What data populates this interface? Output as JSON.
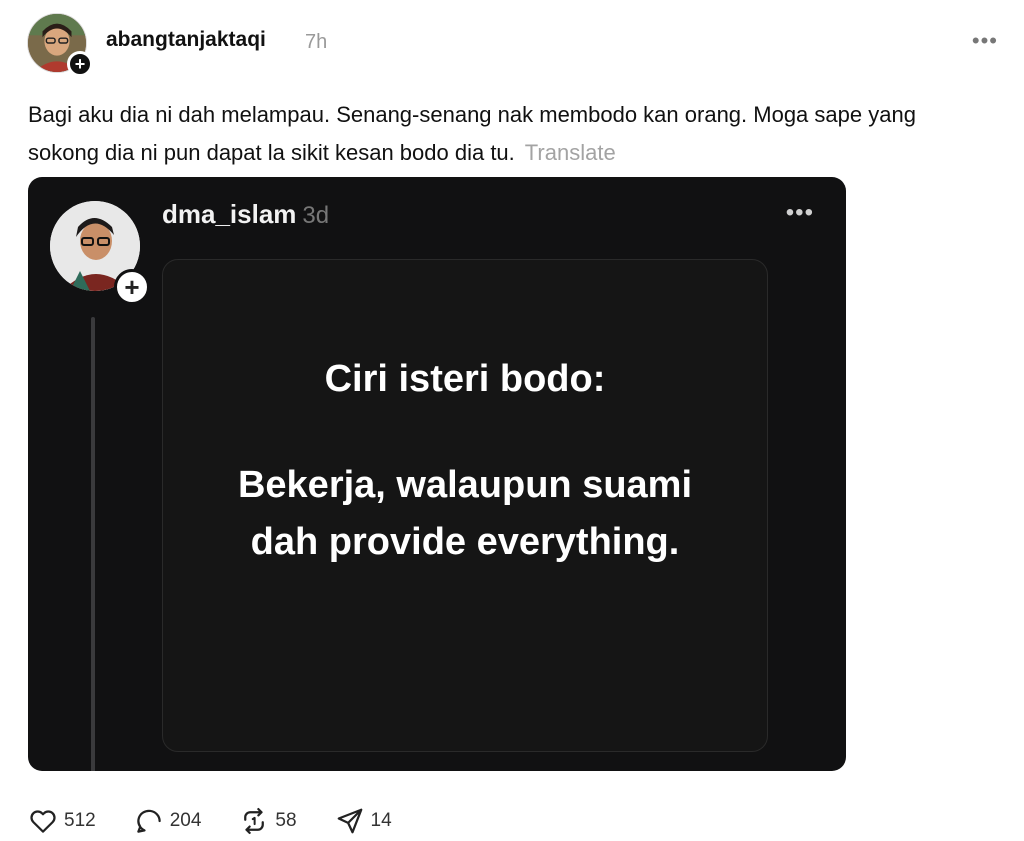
{
  "post": {
    "author": "abangtanjaktaqi",
    "time": "7h",
    "more": "•••",
    "follow": "+",
    "caption": "Bagi aku dia ni dah melampau. Senang-senang nak membodo kan orang. Moga sape yang sokong dia ni pun dapat la sikit kesan bodo dia tu.",
    "translate": "Translate"
  },
  "embedded": {
    "author": "dma_islam",
    "time": "3d",
    "more": "•••",
    "follow": "+",
    "title": "Ciri isteri bodo:",
    "body": "Bekerja, walaupun suami dah provide everything."
  },
  "actions": {
    "likes": "512",
    "replies": "204",
    "reposts": "58",
    "shares": "14"
  },
  "colors": {
    "muted": "#9a9a9a",
    "dark_card": "#111112",
    "text": "#111111"
  }
}
